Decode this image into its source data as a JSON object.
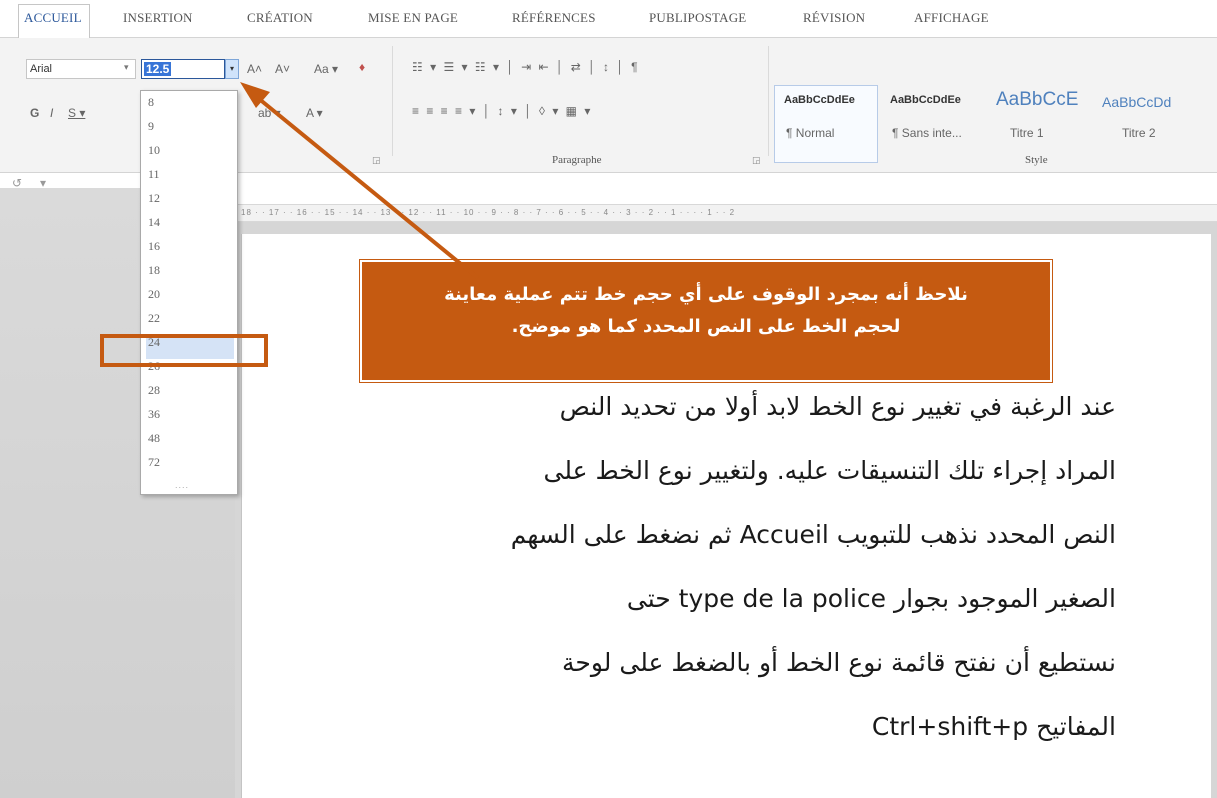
{
  "tabs": [
    {
      "label": "ACCUEIL",
      "active": true
    },
    {
      "label": "INSERTION"
    },
    {
      "label": "CRÉATION"
    },
    {
      "label": "MISE EN PAGE"
    },
    {
      "label": "RÉFÉRENCES"
    },
    {
      "label": "PUBLIPOSTAGE"
    },
    {
      "label": "RÉVISION"
    },
    {
      "label": "AFFICHAGE"
    }
  ],
  "font": {
    "name": "Arial",
    "size": "12.5",
    "grow": "A˄",
    "shrink": "A˅",
    "case": "Aa ▾",
    "bold": "G",
    "italic": "I",
    "underline": "S ▾",
    "color_btn": "A ▾",
    "highlight_btn": "ab ▾",
    "eraser": "♦"
  },
  "size_options": [
    "8",
    "9",
    "10",
    "11",
    "12",
    "14",
    "16",
    "18",
    "20",
    "22",
    "24",
    "26",
    "28",
    "36",
    "48",
    "72"
  ],
  "size_hovered": "24",
  "size_grip": "....",
  "paragraph": {
    "label": "Paragraphe",
    "row1": "☷ ▾ ☰ ▾ ☷ ▾ │ ⇥ ⇤ │ ⇄ │ ↕ │ ¶",
    "row2": "≡ ≡ ≡ ≡ ▾ │ ↕ ▾ │ ◊ ▾ ▦ ▾"
  },
  "styles": {
    "label": "Style",
    "items": [
      {
        "preview": "AaBbCcDdEe",
        "name": "¶ Normal"
      },
      {
        "preview": "AaBbCcDdEe",
        "name": "¶ Sans inte..."
      },
      {
        "preview": "AaBbCcE",
        "name": "Titre 1"
      },
      {
        "preview": "AaBbCcDd",
        "name": "Titre 2"
      }
    ]
  },
  "ruler_text": "18 · · 17 · · 16 · · 15 · · 14 · · 13 · · 12 · · 11 · · 10 · · 9 · · 8 · · 7 · · 6 · · 5 · · 4 · · 3 · · 2 · · 1 · · · · 1 · · 2",
  "callout": {
    "line1": "نلاحظ أنه بمجرد الوقوف على أي حجم خط  تتم عملية معاينة",
    "line2": "لحجم الخط على النص المحدد كما هو موضح."
  },
  "document": {
    "lines": [
      "عند الرغبة في تغيير نوع الخط لابد أولا من تحديد النص",
      "المراد إجراء تلك التنسيقات عليه. ولتغيير نوع الخط على",
      "النص المحدد نذهب للتبويب Accueil ثم نضغط على السهم",
      "الصغير الموجود بجوار type de la police حتى",
      "نستطيع أن نفتح قائمة نوع الخط أو بالضغط على لوحة",
      "المفاتيح Ctrl+shift+p"
    ]
  },
  "colors": {
    "accent": "#c55a11",
    "ribbon_blue": "#2b579a",
    "hover_blue": "#d5e3f6"
  },
  "icons": {
    "undo": "↺",
    "qa_more": "▾"
  }
}
